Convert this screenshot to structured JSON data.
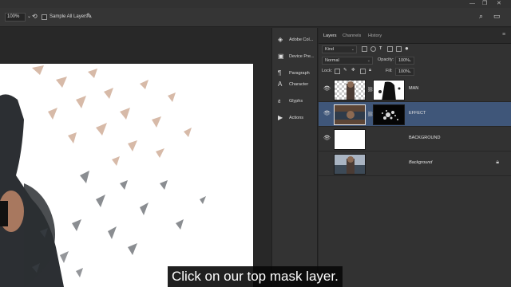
{
  "window": {
    "controls": [
      "—",
      "❐",
      "✕"
    ]
  },
  "options_bar": {
    "zoom_value": "100%",
    "sample_all_layers_label": "Sample All Layers",
    "sample_all_layers_checked": false
  },
  "dock": {
    "items": [
      {
        "label": "Adobe Col...",
        "icon": "adobe-color-icon"
      },
      {
        "label": "Device Pre...",
        "icon": "device-preview-icon"
      },
      {
        "label": "Paragraph",
        "icon": "paragraph-icon"
      },
      {
        "label": "Character",
        "icon": "character-icon"
      },
      {
        "label": "Glyphs",
        "icon": "glyphs-icon"
      },
      {
        "label": "Actions",
        "icon": "play-icon"
      }
    ]
  },
  "layers_panel": {
    "tabs": [
      {
        "label": "Layers",
        "active": true
      },
      {
        "label": "Channels",
        "active": false
      },
      {
        "label": "History",
        "active": false
      }
    ],
    "filter_kind": "Kind",
    "blend_mode": "Normal",
    "opacity_label": "Opacity:",
    "opacity_value": "100%",
    "lock_label": "Lock:",
    "fill_label": "Fill:",
    "fill_value": "100%",
    "layers": [
      {
        "name": "MAN",
        "visible": true,
        "selected": false,
        "has_mask": true,
        "italic": false,
        "locked": false
      },
      {
        "name": "EFFECT",
        "visible": true,
        "selected": true,
        "has_mask": true,
        "italic": false,
        "locked": false
      },
      {
        "name": "BACKGROUND",
        "visible": true,
        "selected": false,
        "has_mask": false,
        "italic": false,
        "locked": false
      },
      {
        "name": "Background",
        "visible": false,
        "selected": false,
        "has_mask": false,
        "italic": true,
        "locked": true
      }
    ]
  },
  "caption": "Click on our top mask layer.",
  "colors": {
    "selected_layer": "#3f5679",
    "panel_bg": "#323232",
    "canvas_bg": "#ffffff"
  }
}
